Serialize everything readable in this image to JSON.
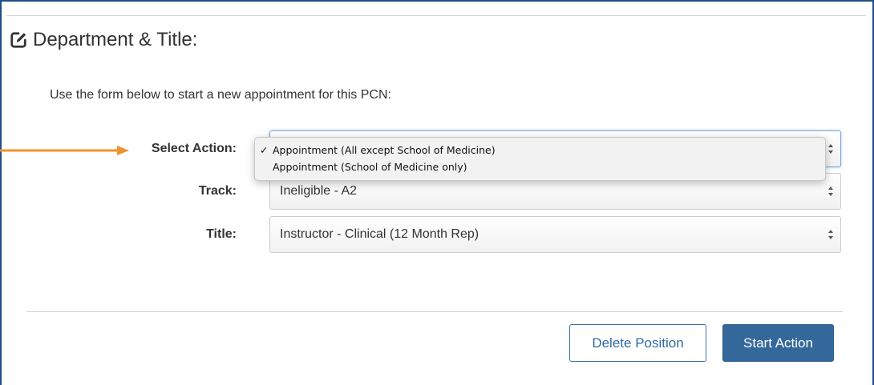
{
  "panel": {
    "title": "Department & Title:",
    "intro": "Use the form below to start a new appointment for this PCN:"
  },
  "form": {
    "select_action": {
      "label": "Select Action:",
      "value": "",
      "options": [
        {
          "label": "Appointment (All except School of Medicine)",
          "checked": "✓"
        },
        {
          "label": "Appointment (School of Medicine only)",
          "checked": ""
        }
      ]
    },
    "track": {
      "label": "Track:",
      "value": "Ineligible - A2"
    },
    "title": {
      "label": "Title:",
      "value": "Instructor - Clinical (12 Month Rep)"
    }
  },
  "buttons": {
    "delete_label": "Delete Position",
    "start_label": "Start Action"
  },
  "icons": {
    "title_icon": "edit-icon",
    "select_icon": "updown-icon",
    "annotation": "orange-arrow"
  },
  "colors": {
    "frame": "#1f4f8a",
    "primary": "#35689a",
    "annotation_arrow": "#f0922e"
  }
}
